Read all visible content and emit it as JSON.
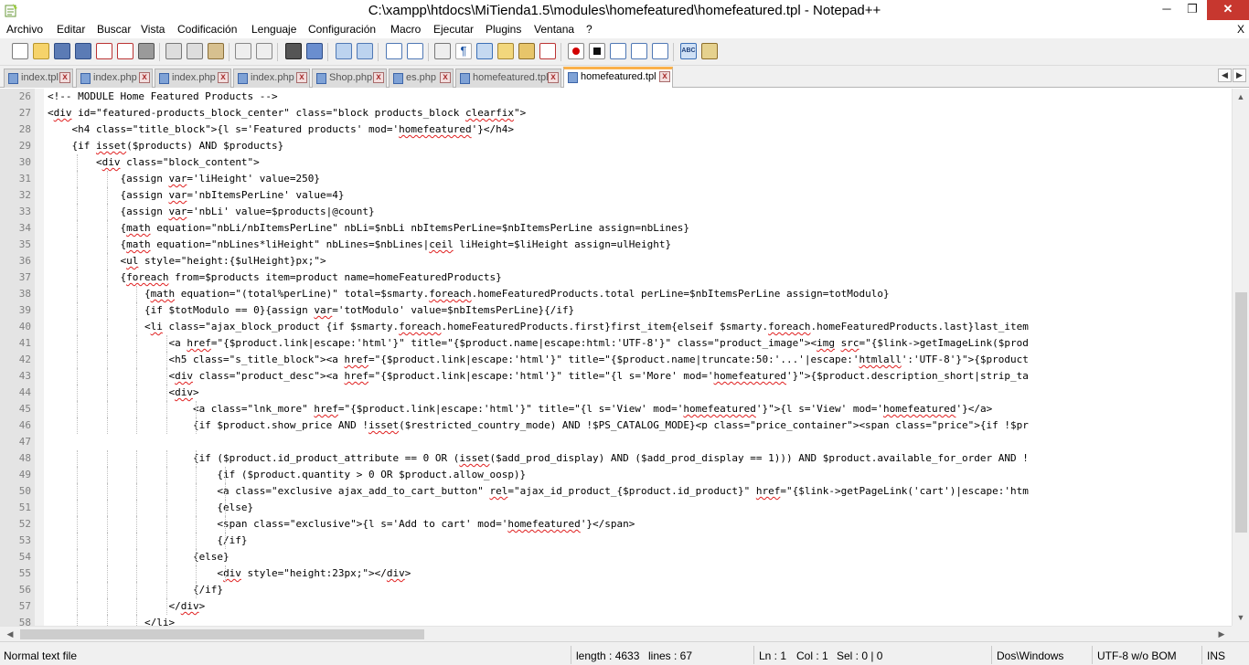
{
  "window": {
    "title": "C:\\xampp\\htdocs\\MiTienda1.5\\modules\\homefeatured\\homefeatured.tpl - Notepad++",
    "minimize": "─",
    "maximize": "❐",
    "close": "✕"
  },
  "menu": {
    "items": [
      "Archivo",
      "Editar",
      "Buscar",
      "Vista",
      "Codificación",
      "Lenguaje",
      "Configuración",
      "Macro",
      "Ejecutar",
      "Plugins",
      "Ventana",
      "?"
    ],
    "close": "X"
  },
  "toolbar": {
    "icons": [
      "new-file-icon",
      "open-file-icon",
      "save-icon",
      "save-all-icon",
      "close-icon",
      "close-all-icon",
      "print-icon",
      "cut-icon",
      "copy-icon",
      "paste-icon",
      "undo-icon",
      "redo-icon",
      "find-icon",
      "replace-icon",
      "zoom-in-icon",
      "zoom-out-icon",
      "sync-vertical-icon",
      "sync-horizontal-icon",
      "word-wrap-icon",
      "show-all-chars-icon",
      "indent-guide-icon",
      "user-language-icon",
      "document-map-icon",
      "function-list-icon",
      "record-macro-icon",
      "stop-record-icon",
      "play-macro-icon",
      "run-macro-multiple-icon",
      "save-macro-icon",
      "spell-check-icon",
      "clipboard-icon"
    ]
  },
  "tabs": [
    {
      "label": "index.tpl",
      "close": "x"
    },
    {
      "label": "index.php",
      "close": "x"
    },
    {
      "label": "index.php",
      "close": "x"
    },
    {
      "label": "index.php",
      "close": "x"
    },
    {
      "label": "Shop.php",
      "close": "x"
    },
    {
      "label": "es.php",
      "close": "x"
    },
    {
      "label": "homefeatured.tpl",
      "close": "x"
    },
    {
      "label": "homefeatured.tpl",
      "close": "x",
      "active": true
    }
  ],
  "tab_arrows": {
    "left": "◀",
    "right": "▶"
  },
  "editor": {
    "lines": [
      {
        "n": "26",
        "text": "<!-- MODULE Home Featured Products -->"
      },
      {
        "n": "27",
        "text": "<div id=\"featured-products_block_center\" class=\"block products_block clearfix\">"
      },
      {
        "n": "28",
        "text": "    <h4 class=\"title_block\">{l s='Featured products' mod='homefeatured'}</h4>"
      },
      {
        "n": "29",
        "text": "    {if isset($products) AND $products}"
      },
      {
        "n": "30",
        "text": "        <div class=\"block_content\">"
      },
      {
        "n": "31",
        "text": "            {assign var='liHeight' value=250}"
      },
      {
        "n": "32",
        "text": "            {assign var='nbItemsPerLine' value=4}"
      },
      {
        "n": "33",
        "text": "            {assign var='nbLi' value=$products|@count}"
      },
      {
        "n": "34",
        "text": "            {math equation=\"nbLi/nbItemsPerLine\" nbLi=$nbLi nbItemsPerLine=$nbItemsPerLine assign=nbLines}"
      },
      {
        "n": "35",
        "text": "            {math equation=\"nbLines*liHeight\" nbLines=$nbLines|ceil liHeight=$liHeight assign=ulHeight}"
      },
      {
        "n": "36",
        "text": "            <ul style=\"height:{$ulHeight}px;\">"
      },
      {
        "n": "37",
        "text": "            {foreach from=$products item=product name=homeFeaturedProducts}"
      },
      {
        "n": "38",
        "text": "                {math equation=\"(total%perLine)\" total=$smarty.foreach.homeFeaturedProducts.total perLine=$nbItemsPerLine assign=totModulo}"
      },
      {
        "n": "39",
        "text": "                {if $totModulo == 0}{assign var='totModulo' value=$nbItemsPerLine}{/if}"
      },
      {
        "n": "40",
        "text": "                <li class=\"ajax_block_product {if $smarty.foreach.homeFeaturedProducts.first}first_item{elseif $smarty.foreach.homeFeaturedProducts.last}last_item"
      },
      {
        "n": "41",
        "text": "                    <a href=\"{$product.link|escape:'html'}\" title=\"{$product.name|escape:html:'UTF-8'}\" class=\"product_image\"><img src=\"{$link->getImageLink($prod"
      },
      {
        "n": "42",
        "text": "                    <h5 class=\"s_title_block\"><a href=\"{$product.link|escape:'html'}\" title=\"{$product.name|truncate:50:'...'|escape:'htmlall':'UTF-8'}\">{$product"
      },
      {
        "n": "43",
        "text": "                    <div class=\"product_desc\"><a href=\"{$product.link|escape:'html'}\" title=\"{l s='More' mod='homefeatured'}\">{$product.description_short|strip_ta"
      },
      {
        "n": "44",
        "text": "                    <div>"
      },
      {
        "n": "45",
        "text": "                        <a class=\"lnk_more\" href=\"{$product.link|escape:'html'}\" title=\"{l s='View' mod='homefeatured'}\">{l s='View' mod='homefeatured'}</a>"
      },
      {
        "n": "46",
        "text": "                        {if $product.show_price AND !isset($restricted_country_mode) AND !$PS_CATALOG_MODE}<p class=\"price_container\"><span class=\"price\">{if !$pr"
      },
      {
        "n": "47",
        "text": ""
      },
      {
        "n": "48",
        "text": "                        {if ($product.id_product_attribute == 0 OR (isset($add_prod_display) AND ($add_prod_display == 1))) AND $product.available_for_order AND !"
      },
      {
        "n": "49",
        "text": "                            {if ($product.quantity > 0 OR $product.allow_oosp)}"
      },
      {
        "n": "50",
        "text": "                            <a class=\"exclusive ajax_add_to_cart_button\" rel=\"ajax_id_product_{$product.id_product}\" href=\"{$link->getPageLink('cart')|escape:'htm"
      },
      {
        "n": "51",
        "text": "                            {else}"
      },
      {
        "n": "52",
        "text": "                            <span class=\"exclusive\">{l s='Add to cart' mod='homefeatured'}</span>"
      },
      {
        "n": "53",
        "text": "                            {/if}"
      },
      {
        "n": "54",
        "text": "                        {else}"
      },
      {
        "n": "55",
        "text": "                            <div style=\"height:23px;\"></div>"
      },
      {
        "n": "56",
        "text": "                        {/if}"
      },
      {
        "n": "57",
        "text": "                    </div>"
      },
      {
        "n": "58",
        "text": "                </li>"
      }
    ]
  },
  "scroll": {
    "up": "▲",
    "down": "▼",
    "left": "◀",
    "right": "▶"
  },
  "status": {
    "filetype": "Normal text file",
    "length": "length : 4633",
    "lines": "lines : 67",
    "ln": "Ln : 1",
    "col": "Col : 1",
    "sel": "Sel : 0 | 0",
    "eol": "Dos\\Windows",
    "encoding": "UTF-8 w/o BOM",
    "mode": "INS"
  },
  "colors": {
    "active_tab_accent": "#fab04a",
    "close_button": "#c7372f",
    "gutter": "#e4e4e4"
  }
}
